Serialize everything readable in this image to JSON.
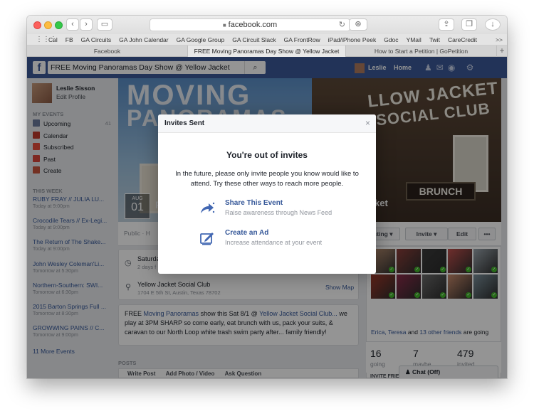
{
  "browser": {
    "url": "facebook.com",
    "favorites": [
      "Cal",
      "FB",
      "GA Circuits",
      "GA John Calendar",
      "GA Google Group",
      "GA Circuit Slack",
      "GA FrontRow",
      "iPad/iPhone Peek",
      "Gdoc",
      "YMail",
      "Twit",
      "CareCredit"
    ],
    "more": ">>",
    "tabs": [
      "Facebook",
      "FREE Moving Panoramas Day Show @ Yellow Jacket",
      "How to Start a Petition | GoPetition"
    ]
  },
  "fb": {
    "search_value": "FREE Moving Panoramas Day Show @ Yellow Jacket",
    "user_name": "Leslie",
    "home": "Home"
  },
  "sidebar": {
    "name": "Leslie Sisson",
    "edit": "Edit Profile",
    "my_events": "MY EVENTS",
    "items": [
      {
        "label": "Upcoming",
        "count": "41",
        "color": "#6b7b9e"
      },
      {
        "label": "Calendar",
        "count": "",
        "color": "#c0392b"
      },
      {
        "label": "Subscribed",
        "count": "",
        "color": "#e74c3c"
      },
      {
        "label": "Past",
        "count": "",
        "color": "#d9463a"
      },
      {
        "label": "Create",
        "count": "",
        "color": "#c8553d"
      }
    ],
    "this_week": "THIS WEEK",
    "events": [
      {
        "title": "RUBY FRAY // JULIA LU...",
        "time": "Today at 9:00pm"
      },
      {
        "title": "Crocodile Tears // Ex-Legi...",
        "time": "Today at 9:00pm"
      },
      {
        "title": "The Return of The Shake...",
        "time": "Today at 9:00pm"
      },
      {
        "title": "John Wesley Coleman'Li...",
        "time": "Tomorrow at 5:30pm"
      },
      {
        "title": "Northern-Southern: SWI...",
        "time": "Tomorrow at 6:30pm"
      },
      {
        "title": "2015 Barton Springs Full ...",
        "time": "Tomorrow at 8:30pm"
      },
      {
        "title": "GROWWING PAINS // C...",
        "time": "Tomorrow at 9:00pm"
      }
    ],
    "more": "11 More Events"
  },
  "cover": {
    "line1": "MOVING",
    "line2": "PANORAMAS",
    "sign1": "LLOW JACKET",
    "sign2": "SOCIAL CLUB",
    "brunch": "BRUNCH",
    "month": "AUG",
    "day": "01",
    "title_left": "F",
    "title_right": "ket"
  },
  "actions": {
    "public": "Public · H",
    "going": "sting ▾",
    "invite": "Invite ▾",
    "edit": "Edit",
    "more": "•••"
  },
  "details": {
    "date_line": "Saturday",
    "date_sub": "2 days f",
    "venue": "Yellow Jacket Social Club",
    "address": "1704 E 5th St, Austin, Texas 78702",
    "show_map": "Show Map"
  },
  "description": {
    "prefix": "FREE ",
    "link1": "Moving Panoramas",
    "mid": " show this Sat 8/1 @ ",
    "link2": "Yellow Jacket Social Club...",
    "rest": " we play at 3PM SHARP so come early, eat brunch with us, pack your suits, & caravan to our North Loop white trash swim party after... family friendly!"
  },
  "posts": {
    "label": "POSTS",
    "write": "Write Post",
    "photo": "Add Photo / Video",
    "ask": "Ask Question"
  },
  "going": {
    "names": "Erica, Teresa",
    "and": " and ",
    "others": "13 other friends",
    "suffix": " are going",
    "stats": [
      {
        "n": "16",
        "l": "going"
      },
      {
        "n": "7",
        "l": "maybe"
      },
      {
        "n": "479",
        "l": "invited"
      }
    ],
    "invite_friends": "INVITE FRIE"
  },
  "chat": "Chat (Off)",
  "modal": {
    "title": "Invites Sent",
    "heading": "You're out of invites",
    "body": "In the future, please only invite people you know would like to attend. Try these other ways to reach more people.",
    "options": [
      {
        "title": "Share This Event",
        "sub": "Raise awareness through News Feed",
        "icon": "share-icon"
      },
      {
        "title": "Create an Ad",
        "sub": "Increase attendance at your event",
        "icon": "create-ad-icon"
      }
    ],
    "close": "×"
  },
  "colors": {
    "fb_blue": "#3b5998",
    "link": "#365899"
  }
}
